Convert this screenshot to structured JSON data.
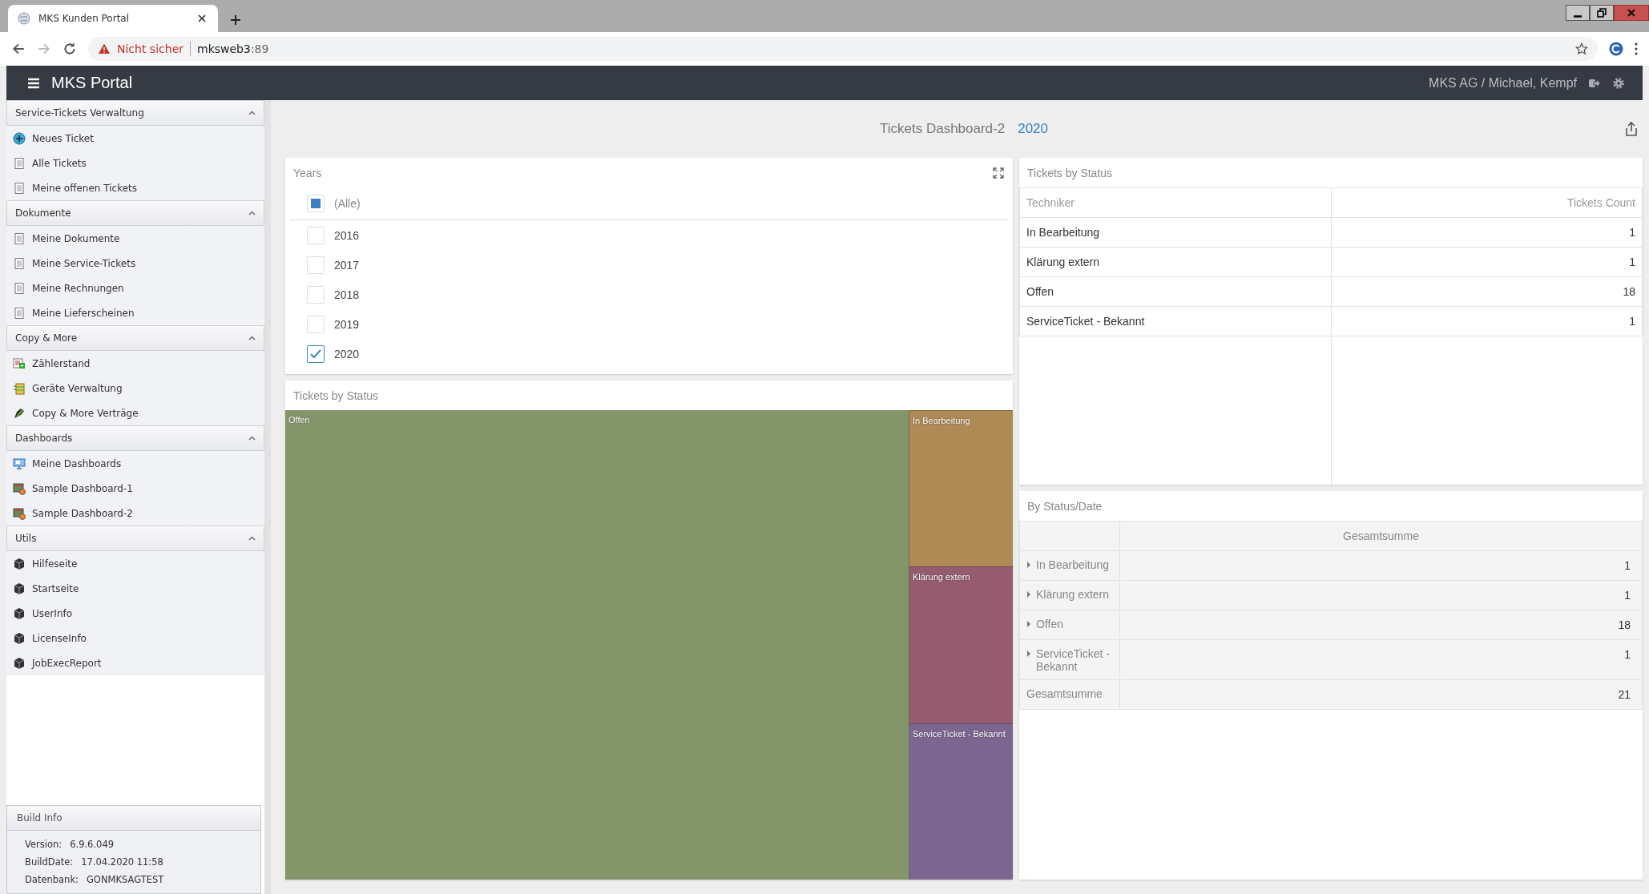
{
  "browser": {
    "tab_title": "MKS Kunden Portal",
    "security": "Nicht sicher",
    "url_host": "mksweb3",
    "url_port": ":89"
  },
  "app": {
    "title": "MKS Portal",
    "user": "MKS AG / Michael, Kempf"
  },
  "sidebar": {
    "sections": [
      {
        "title": "Service-Tickets Verwaltung",
        "items": [
          {
            "label": "Neues Ticket",
            "kind": "plus"
          },
          {
            "label": "Alle Tickets",
            "kind": "doc"
          },
          {
            "label": "Meine offenen Tickets",
            "kind": "doc"
          }
        ]
      },
      {
        "title": "Dokumente",
        "items": [
          {
            "label": "Meine Dokumente",
            "kind": "doc"
          },
          {
            "label": "Meine Service-Tickets",
            "kind": "doc"
          },
          {
            "label": "Meine Rechnungen",
            "kind": "doc"
          },
          {
            "label": "Meine Lieferscheinen",
            "kind": "doc"
          }
        ]
      },
      {
        "title": "Copy & More",
        "items": [
          {
            "label": "Zählerstand",
            "kind": "counter"
          },
          {
            "label": "Geräte Verwaltung",
            "kind": "devices"
          },
          {
            "label": "Copy & More Verträge",
            "kind": "contract"
          }
        ]
      },
      {
        "title": "Dashboards",
        "items": [
          {
            "label": "Meine Dashboards",
            "kind": "monitor"
          },
          {
            "label": "Sample Dashboard-1",
            "kind": "dashboard"
          },
          {
            "label": "Sample Dashboard-2",
            "kind": "dashboard"
          }
        ]
      },
      {
        "title": "Utils",
        "items": [
          {
            "label": "Hilfeseite",
            "kind": "cube"
          },
          {
            "label": "Startseite",
            "kind": "cube"
          },
          {
            "label": "UserInfo",
            "kind": "cube"
          },
          {
            "label": "LicenseInfo",
            "kind": "cube"
          },
          {
            "label": "JobExecReport",
            "kind": "cube"
          }
        ]
      }
    ],
    "build_info": {
      "title": "Build Info",
      "rows": [
        {
          "label": "Version:",
          "value": "6.9.6.049"
        },
        {
          "label": "BuildDate:",
          "value": "17.04.2020 11:58"
        },
        {
          "label": "Datenbank:",
          "value": "GONMKSAGTEST"
        }
      ]
    }
  },
  "dashboard": {
    "title": "Tickets Dashboard-2",
    "filter_value": "2020"
  },
  "years": {
    "title": "Years",
    "all": {
      "label": "(Alle)",
      "indeterminate": true
    },
    "items": [
      {
        "label": "2016",
        "checked": false
      },
      {
        "label": "2017",
        "checked": false
      },
      {
        "label": "2018",
        "checked": false
      },
      {
        "label": "2019",
        "checked": false
      },
      {
        "label": "2020",
        "checked": true
      }
    ]
  },
  "treemap": {
    "title": "Tickets by Status",
    "tiles": [
      {
        "label": "Offen",
        "color": "#85956a"
      },
      {
        "label": "In Bearbeitung",
        "color": "#ae8a55"
      },
      {
        "label": "Klärung extern",
        "color": "#955c70"
      },
      {
        "label": "ServiceTicket - Bekannt",
        "color": "#7c6690"
      }
    ]
  },
  "status_table": {
    "title": "Tickets by Status",
    "columns": [
      "Techniker",
      "Tickets Count"
    ],
    "rows": [
      [
        "In Bearbeitung",
        "1"
      ],
      [
        "Klärung extern",
        "1"
      ],
      [
        "Offen",
        "18"
      ],
      [
        "ServiceTicket - Bekannt",
        "1"
      ]
    ]
  },
  "pivot": {
    "title": "By Status/Date",
    "column": "Gesamtsumme",
    "rows": [
      {
        "label": "In Bearbeitung",
        "value": "1"
      },
      {
        "label": "Klärung extern",
        "value": "1"
      },
      {
        "label": "Offen",
        "value": "18"
      },
      {
        "label": "ServiceTicket - Bekannt",
        "value": "1"
      }
    ],
    "total": {
      "label": "Gesamtsumme",
      "value": "21"
    }
  }
}
